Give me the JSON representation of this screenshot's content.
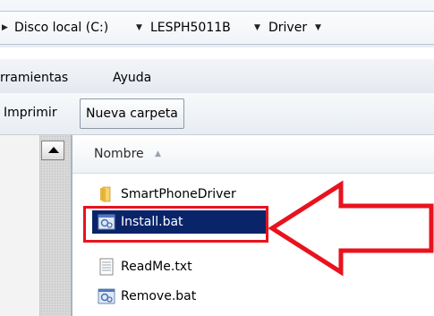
{
  "address_bar": {
    "segments": [
      "Disco local (C:)",
      "LESPH5011B",
      "Driver"
    ]
  },
  "menu": {
    "items": [
      "rramientas",
      "Ayuda"
    ]
  },
  "toolbar": {
    "print_label": "Imprimir",
    "new_folder_label": "Nueva carpeta"
  },
  "file_list": {
    "column_header": "Nombre",
    "files": [
      {
        "name": "SmartPhoneDriver",
        "type": "folder"
      },
      {
        "name": "Install.bat",
        "type": "batch",
        "selected": true
      },
      {
        "name": "ReadMe.txt",
        "type": "text"
      },
      {
        "name": "Remove.bat",
        "type": "batch"
      }
    ]
  },
  "annotation": {
    "color": "#e8131e"
  },
  "colors": {
    "selection": "#0a246a"
  }
}
